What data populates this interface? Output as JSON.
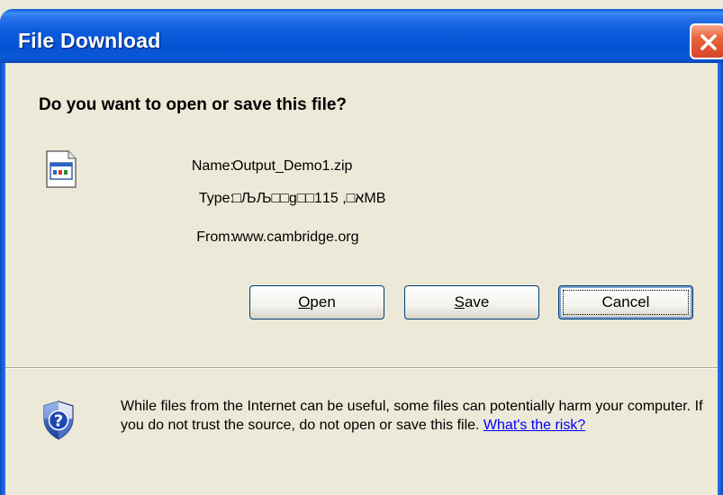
{
  "window": {
    "title": "File Download"
  },
  "dialog": {
    "question": "Do you want to open or save this file?",
    "fields": {
      "name_label": "Name:",
      "name_value": "Output_Demo1.zip",
      "type_label": "Type:",
      "type_value": "□ЉЉ□□g□□א□, 115MB",
      "from_label": "From:",
      "from_value": "www.cambridge.org"
    },
    "buttons": {
      "open_pre": "",
      "open_mnemonic": "O",
      "open_post": "pen",
      "save_pre": "",
      "save_mnemonic": "S",
      "save_post": "ave",
      "cancel": "Cancel"
    },
    "warning": {
      "text": "While files from the Internet can be useful, some files can potentially harm your computer. If you do not trust the source, do not open or save this file.",
      "link": "What's the risk?"
    }
  },
  "icons": {
    "close": "close-icon",
    "file": "file-icon",
    "shield": "shield-icon"
  },
  "colors": {
    "titlebar": "#0a5bd6",
    "dialog_bg": "#ece9d8",
    "close_button": "#d8452a",
    "link": "#0000ff"
  }
}
